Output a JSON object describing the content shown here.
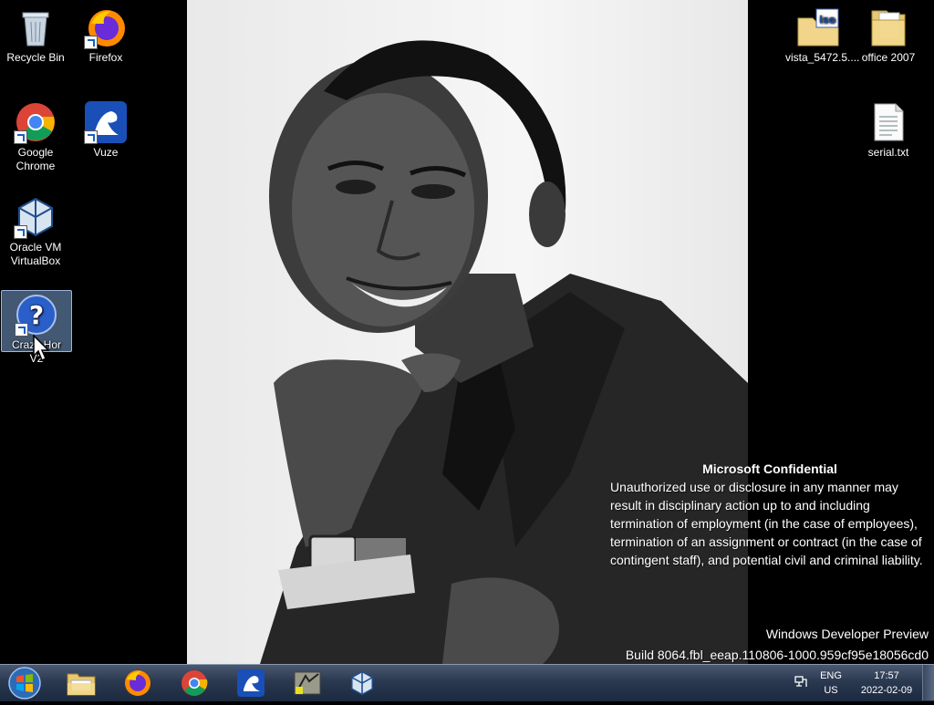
{
  "desktop": {
    "icons_left": [
      {
        "label": "Recycle Bin",
        "icon": "recycle-bin-icon"
      },
      {
        "label": "Firefox",
        "icon": "firefox-icon"
      },
      {
        "label": "Google Chrome",
        "icon": "chrome-icon"
      },
      {
        "label": "Vuze",
        "icon": "vuze-icon"
      },
      {
        "label": "Oracle VM VirtualBox",
        "icon": "virtualbox-icon"
      },
      {
        "label": "Crazy Hor V2",
        "icon": "help-question-icon"
      }
    ],
    "icons_right": [
      {
        "label": "vista_5472.5....",
        "icon": "iso-folder-icon"
      },
      {
        "label": "office 2007",
        "icon": "folder-icon"
      },
      {
        "label": "serial.txt",
        "icon": "text-file-icon"
      }
    ]
  },
  "watermark": {
    "title": "Microsoft Confidential",
    "body": "Unauthorized use or disclosure in any manner may result in disciplinary action up to and including termination of employment (in the case of employees), termination of an assignment or contract (in the case of contingent staff), and potential civil and criminal liability.",
    "product": "Windows Developer Preview",
    "build": "Build 8064.fbl_eeap.110806-1000.959cf95e18056cd0"
  },
  "taskbar": {
    "pinned": [
      "file-explorer-icon",
      "firefox-icon",
      "chrome-icon",
      "vuze-icon",
      "app-icon",
      "virtualbox-icon"
    ],
    "language": "ENG",
    "region": "US",
    "time": "17:57",
    "date": "2022-02-09"
  },
  "colors": {
    "taskbar": "#2a3850",
    "selection": "#7aa0d2",
    "desktop_bg": "#000000"
  }
}
